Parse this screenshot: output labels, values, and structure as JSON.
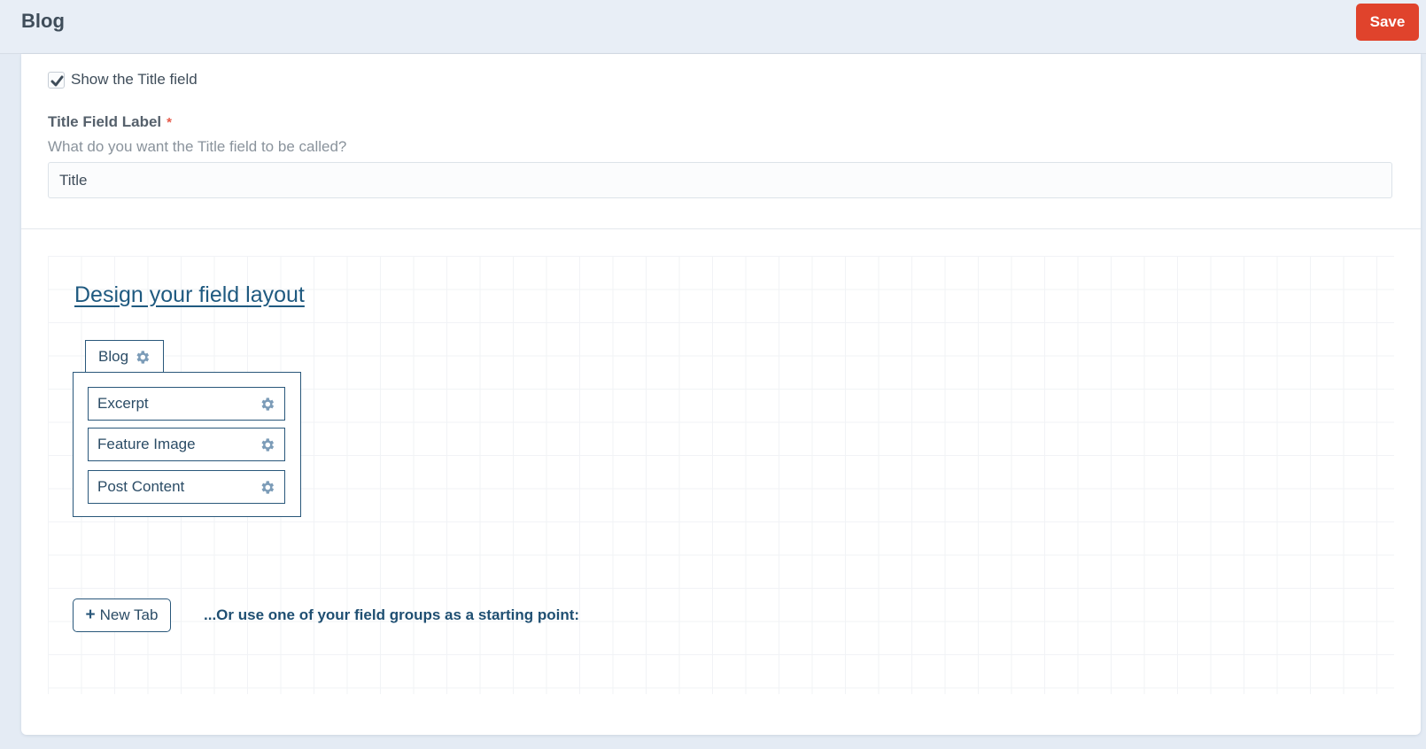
{
  "header": {
    "title": "Blog",
    "save_label": "Save"
  },
  "settings": {
    "show_title": {
      "label": "Show the Title field",
      "checked": true
    },
    "title_field_label": {
      "label": "Title Field Label",
      "required_marker": "*",
      "instructions": "What do you want the Title field to be called?",
      "value": "Title"
    }
  },
  "layout_designer": {
    "heading": "Design your field layout",
    "tabs": [
      {
        "label": "Blog",
        "icon": "gear-icon",
        "fields": [
          {
            "label": "Excerpt",
            "icon": "gear-icon"
          },
          {
            "label": "Feature Image",
            "icon": "gear-icon"
          },
          {
            "label": "Post Content",
            "icon": "gear-icon"
          }
        ]
      }
    ],
    "new_tab_icon": "+",
    "new_tab_label": "New Tab",
    "field_groups_prompt": "...Or use one of your field groups as a starting point:"
  },
  "colors": {
    "accent": "#e0432c",
    "link": "#1f5a80",
    "border": "#29577a",
    "gear": "#7c9cb8",
    "required": "#e65a4a"
  }
}
